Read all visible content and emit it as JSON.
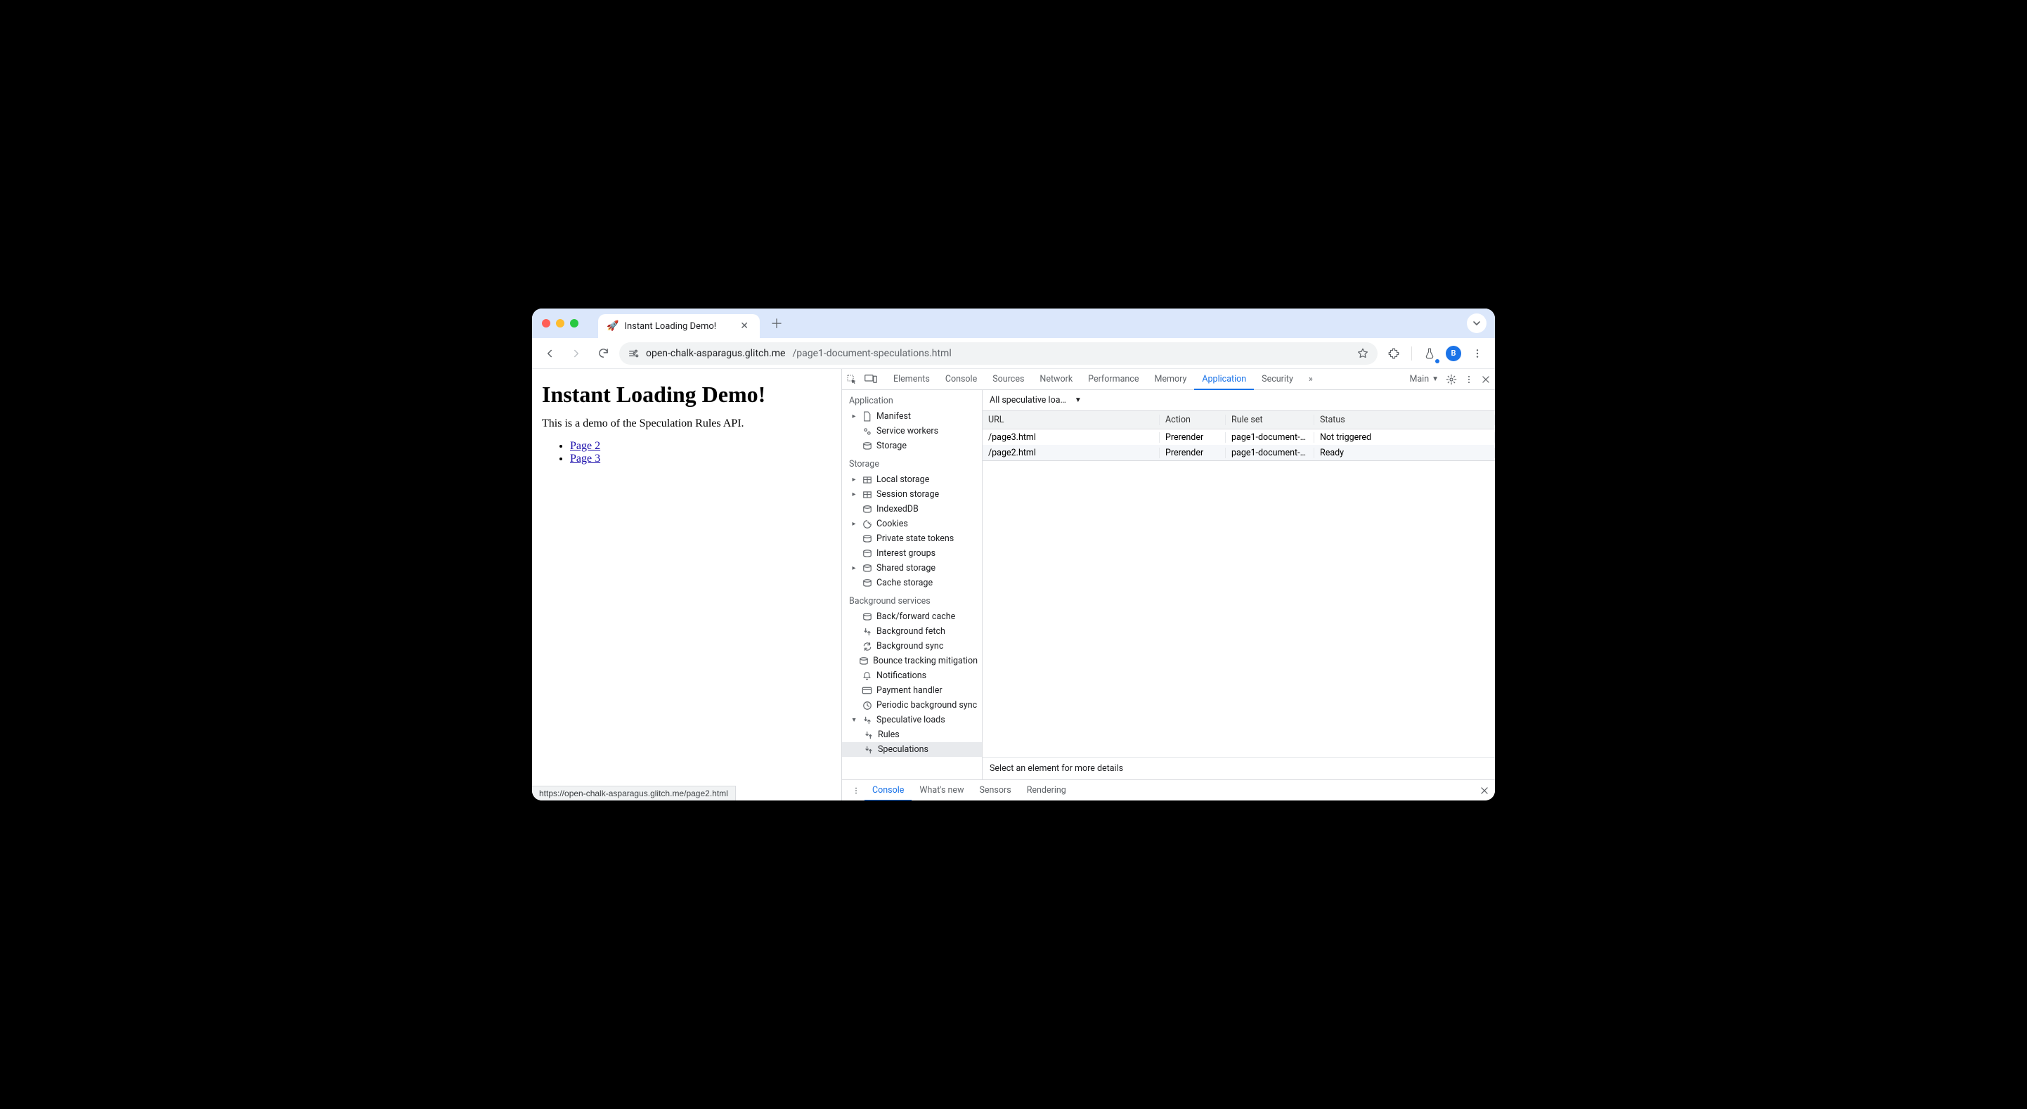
{
  "browser": {
    "tab_title": "Instant Loading Demo!",
    "favicon": "🚀",
    "url_host": "open-chalk-asparagus.glitch.me",
    "url_path": "/page1-document-speculations.html",
    "avatar_letter": "B",
    "main_label": "Main"
  },
  "page": {
    "heading": "Instant Loading Demo!",
    "intro": "This is a demo of the Speculation Rules API.",
    "links": [
      "Page 2",
      "Page 3"
    ],
    "status_url": "https://open-chalk-asparagus.glitch.me/page2.html"
  },
  "devtools": {
    "tabs": [
      "Elements",
      "Console",
      "Sources",
      "Network",
      "Performance",
      "Memory",
      "Application",
      "Security"
    ],
    "active_tab": "Application",
    "sidebar": {
      "application": {
        "title": "Application",
        "items": [
          "Manifest",
          "Service workers",
          "Storage"
        ]
      },
      "storage": {
        "title": "Storage",
        "items": [
          "Local storage",
          "Session storage",
          "IndexedDB",
          "Cookies",
          "Private state tokens",
          "Interest groups",
          "Shared storage",
          "Cache storage"
        ]
      },
      "background": {
        "title": "Background services",
        "items": [
          "Back/forward cache",
          "Background fetch",
          "Background sync",
          "Bounce tracking mitigation",
          "Notifications",
          "Payment handler",
          "Periodic background sync",
          "Speculative loads"
        ],
        "spec_children": [
          "Rules",
          "Speculations"
        ],
        "selected": "Speculations"
      }
    },
    "filter_label": "All speculative loa…",
    "table": {
      "headers": [
        "URL",
        "Action",
        "Rule set",
        "Status"
      ],
      "rows": [
        {
          "url": "/page3.html",
          "action": "Prerender",
          "rule": "page1-document-…",
          "status": "Not triggered"
        },
        {
          "url": "/page2.html",
          "action": "Prerender",
          "rule": "page1-document-…",
          "status": "Ready"
        }
      ]
    },
    "detail_msg": "Select an element for more details",
    "drawer": {
      "tabs": [
        "Console",
        "What's new",
        "Sensors",
        "Rendering"
      ],
      "active": "Console"
    }
  }
}
